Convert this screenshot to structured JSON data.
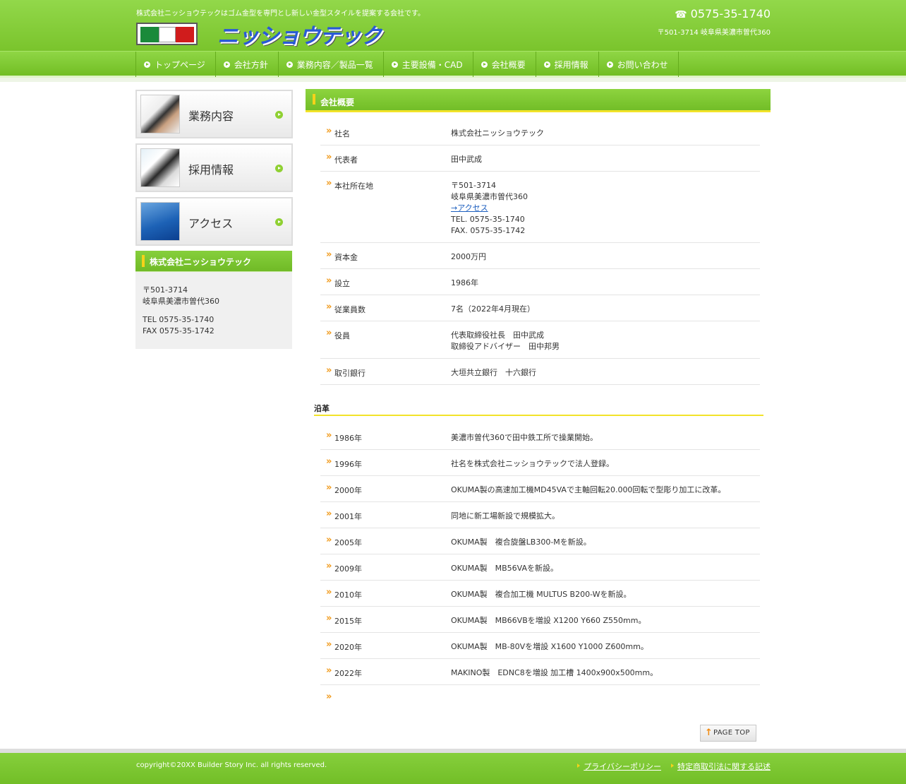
{
  "header": {
    "tagline": "株式会社ニッショウテックはゴム金型を専門とし新しい金型スタイルを提案する会社です。",
    "logo_text": "ニッショウテック",
    "phone": "0575-35-1740",
    "phone_icon": "telephone-icon",
    "address": "〒501-3714 岐阜県美濃市曽代360"
  },
  "nav": {
    "items": [
      {
        "label": "トップページ"
      },
      {
        "label": "会社方針"
      },
      {
        "label": "業務内容／製品一覧"
      },
      {
        "label": "主要設備・CAD"
      },
      {
        "label": "会社概要"
      },
      {
        "label": "採用情報"
      },
      {
        "label": "お問い合わせ"
      }
    ]
  },
  "sidebar": {
    "buttons": [
      {
        "label": "業務内容"
      },
      {
        "label": "採用情報"
      },
      {
        "label": "アクセス"
      }
    ],
    "company": {
      "title": "株式会社ニッショウテック",
      "postal": "〒501-3714",
      "address": "岐阜県美濃市曽代360",
      "tel": "TEL 0575-35-1740",
      "fax": "FAX 0575-35-1742"
    }
  },
  "main": {
    "title": "会社概要",
    "profile": {
      "name": {
        "key": "社名",
        "value": "株式会社ニッショウテック"
      },
      "rep": {
        "key": "代表者",
        "value": "田中武成"
      },
      "hq": {
        "key": "本社所在地",
        "postal": "〒501-3714",
        "address": "岐阜県美濃市曽代360",
        "access_link": "→アクセス",
        "tel": "TEL. 0575-35-1740",
        "fax": "FAX. 0575-35-1742"
      },
      "capital": {
        "key": "資本金",
        "value": "2000万円"
      },
      "founded": {
        "key": "設立",
        "value": "1986年"
      },
      "employees": {
        "key": "従業員数",
        "value": "7名（2022年4月現在）"
      },
      "officers": {
        "key": "役員",
        "line1": "代表取締役社長　田中武成",
        "line2": "取締役アドバイザー　田中邦男"
      },
      "bank": {
        "key": "取引銀行",
        "value": "大垣共立銀行　十六銀行"
      }
    },
    "history_title": "沿革",
    "history": [
      {
        "year": "1986年",
        "text": "美濃市曽代360で田中鉄工所で操業開始。"
      },
      {
        "year": "1996年",
        "text": "社名を株式会社ニッショウテックで法人登録。"
      },
      {
        "year": "2000年",
        "text": "OKUMA製の高速加工機MD45VAで主軸回転20.000回転で型彫り加工に改革。"
      },
      {
        "year": "2001年",
        "text": "同地に新工場新設で規模拡大。"
      },
      {
        "year": "2005年",
        "text": "OKUMA製　複合旋盤LB300-Mを新設。"
      },
      {
        "year": "2009年",
        "text": "OKUMA製　MB56VAを新設。"
      },
      {
        "year": "2010年",
        "text": "OKUMA製　複合加工機 MULTUS B200-Wを新設。"
      },
      {
        "year": "2015年",
        "text": "OKUMA製　MB66VBを増設 X1200 Y660 Z550mm。"
      },
      {
        "year": "2020年",
        "text": "OKUMA製　MB-80Vを増設 X1600 Y1000 Z600mm。"
      },
      {
        "year": "2022年",
        "text": "MAKINO製　EDNC8を増設 加工槽 1400x900x500mm。"
      },
      {
        "year": "",
        "text": ""
      }
    ],
    "pagetop": "PAGE TOP"
  },
  "footer": {
    "copyright": "copyright©20XX Builder Story Inc. all rights reserved.",
    "links": [
      {
        "label": "プライバシーポリシー"
      },
      {
        "label": "特定商取引法に関する記述"
      }
    ]
  }
}
